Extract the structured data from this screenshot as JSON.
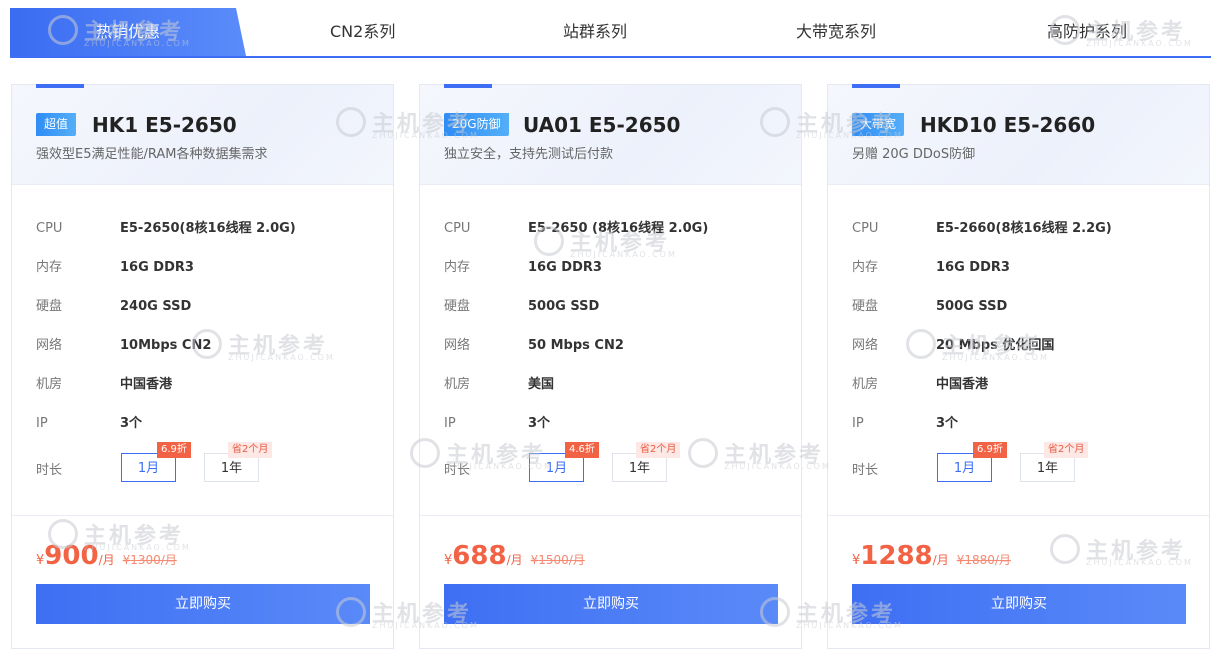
{
  "tabs": [
    "热销优惠",
    "CN2系列",
    "站群系列",
    "大带宽系列",
    "高防护系列"
  ],
  "spec_labels": [
    "CPU",
    "内存",
    "硬盘",
    "网络",
    "机房",
    "IP"
  ],
  "duration_label": "时长",
  "durations": [
    "1月",
    "1年"
  ],
  "buy_label": "立即购买",
  "currency": "¥",
  "per_month": "/月",
  "watermark": {
    "cn": "主机参考",
    "en": "ZHUJICANKAO.COM"
  },
  "cards": [
    {
      "badge": "超值",
      "title": "HK1 E5-2650",
      "subtitle": "强效型E5满足性能/RAM各种数据集需求",
      "specs": [
        "E5-2650(8核16线程 2.0G)",
        "16G DDR3",
        "240G SSD",
        "10Mbps CN2",
        "中国香港",
        "3个"
      ],
      "discount_tag": "6.9折",
      "save_tag": "省2个月",
      "price": "900",
      "old_price": "¥1300/月"
    },
    {
      "badge": "20G防御",
      "title": "UA01 E5-2650",
      "subtitle": "独立安全，支持先测试后付款",
      "specs": [
        "E5-2650 (8核16线程 2.0G)",
        "16G DDR3",
        "500G SSD",
        "50 Mbps CN2",
        "美国",
        "3个"
      ],
      "discount_tag": "4.6折",
      "save_tag": "省2个月",
      "price": "688",
      "old_price": "¥1500/月"
    },
    {
      "badge": "大带宽",
      "title": "HKD10 E5-2660",
      "subtitle": "另赠 20G DDoS防御",
      "specs": [
        "E5-2660(8核16线程 2.2G)",
        "16G DDR3",
        "500G SSD",
        "20 Mbps 优化回国",
        "中国香港",
        "3个"
      ],
      "discount_tag": "6.9折",
      "save_tag": "省2个月",
      "price": "1288",
      "old_price": "¥1880/月"
    }
  ]
}
